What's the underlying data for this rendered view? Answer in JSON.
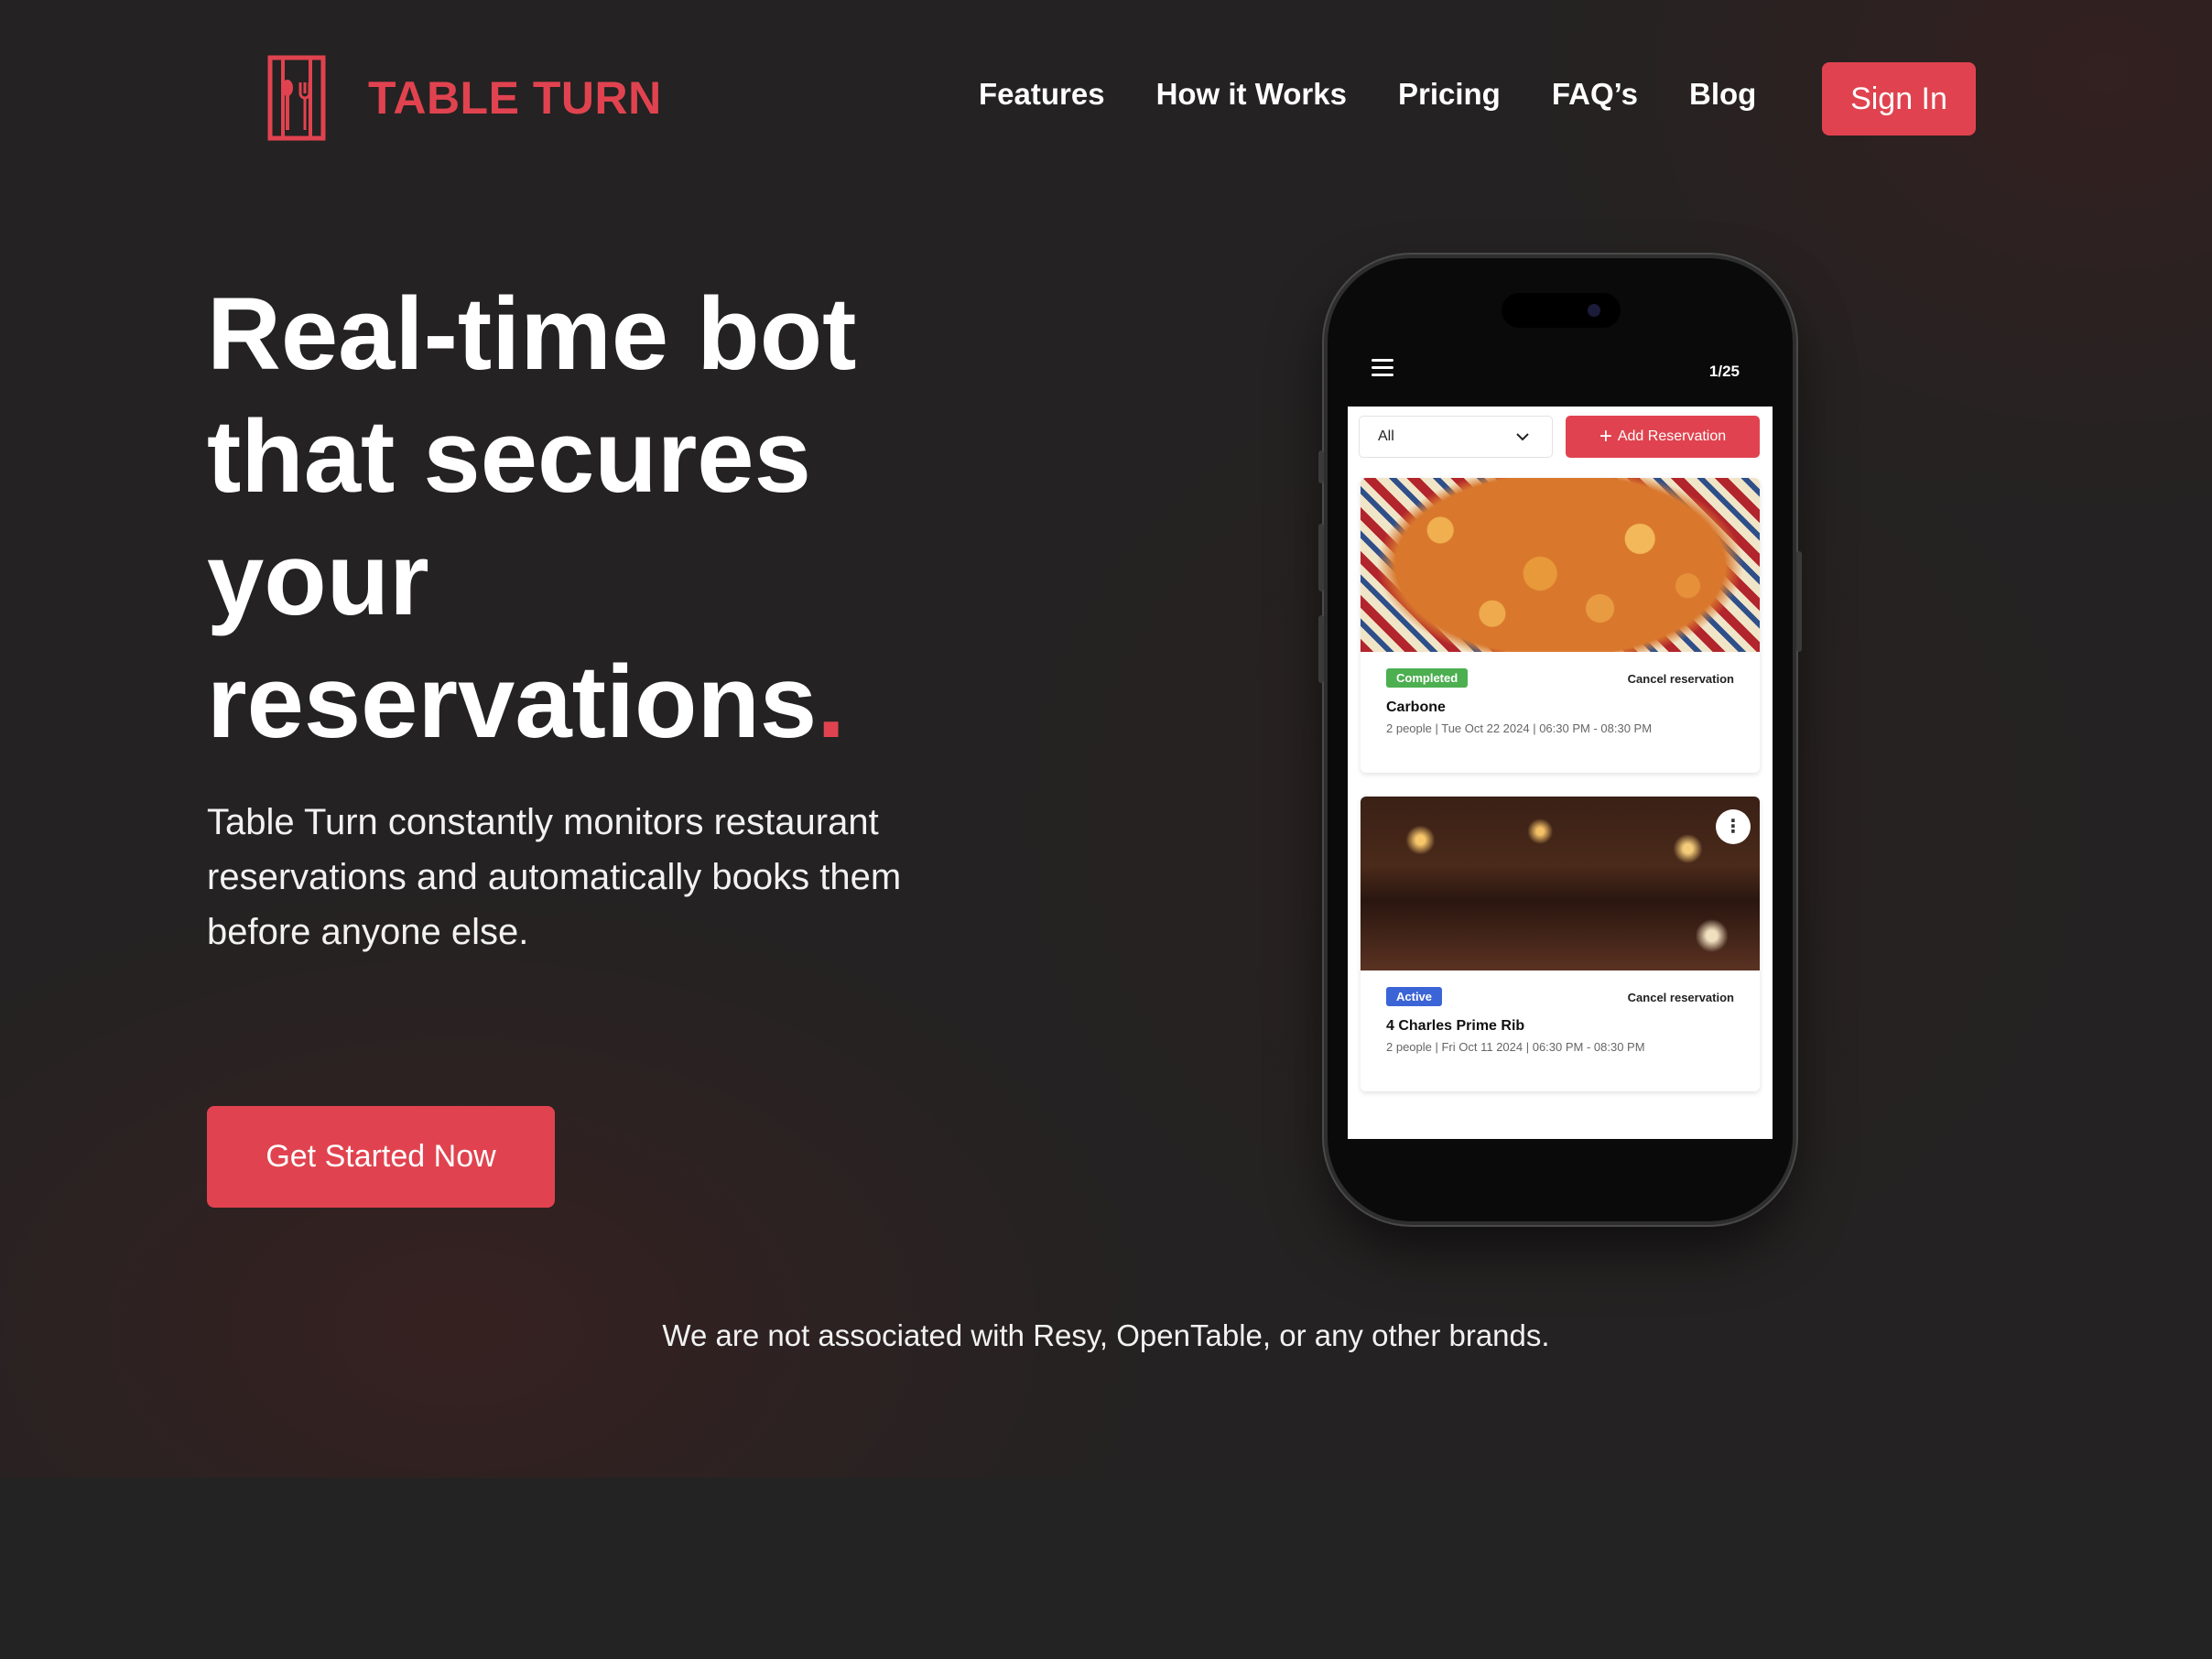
{
  "brand": {
    "name": "TABLE TURN",
    "accent": "#e0434f"
  },
  "nav": {
    "items": [
      "Features",
      "How it Works",
      "Pricing",
      "FAQ’s",
      "Blog"
    ],
    "signin_label": "Sign In"
  },
  "hero": {
    "headline_lines": [
      "Real-time bot",
      "that secures",
      "your",
      "reservations"
    ],
    "headline_dot": ".",
    "subtext": "Table Turn constantly monitors restaurant reservations and automatically books them before anyone else.",
    "cta_label": "Get Started Now",
    "disclaimer": "We are not associated with Resy, OpenTable, or any other brands."
  },
  "phone": {
    "page_count": "1/25",
    "filter_value": "All",
    "add_button_label": "Add Reservation",
    "cards": [
      {
        "status": "Completed",
        "status_color": "#4caf50",
        "cancel_label": "Cancel reservation",
        "restaurant": "Carbone",
        "details": "2 people | Tue Oct 22 2024 | 06:30 PM - 08:30 PM",
        "image": "pasta-dish-photo"
      },
      {
        "status": "Active",
        "status_color": "#3b64d6",
        "cancel_label": "Cancel reservation",
        "restaurant": "4 Charles Prime Rib",
        "details": "2 people | Fri Oct 11 2024 | 06:30 PM - 08:30 PM",
        "image": "restaurant-interior-photo"
      }
    ]
  }
}
